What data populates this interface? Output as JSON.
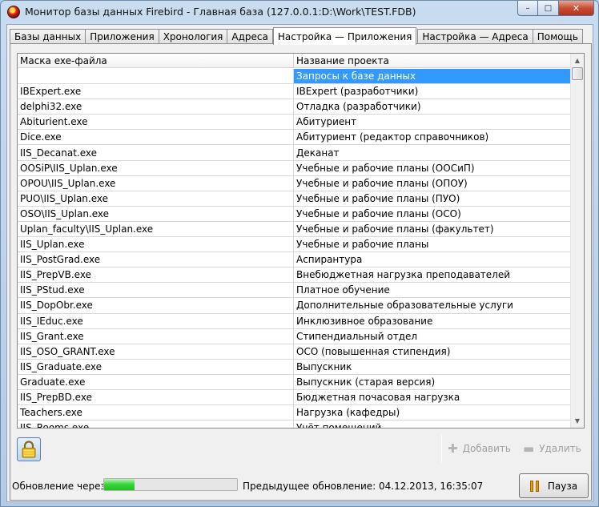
{
  "window": {
    "title": "Монитор базы данных Firebird - Главная база (127.0.0.1:D:\\Work\\TEST.FDB)",
    "controls": {
      "minimize": "–",
      "maximize": "□",
      "close": "✕"
    }
  },
  "tabs": [
    {
      "label": "Базы данных",
      "active": false
    },
    {
      "label": "Приложения",
      "active": false
    },
    {
      "label": "Хронология",
      "active": false
    },
    {
      "label": "Адреса",
      "active": false
    },
    {
      "label": "Настройка — Приложения",
      "active": true
    },
    {
      "label": "Настройка — Адреса",
      "active": false
    },
    {
      "label": "Помощь",
      "active": false
    }
  ],
  "grid": {
    "columns": [
      "Маска exe-файла",
      "Название проекта"
    ],
    "rows": [
      {
        "mask": "",
        "project": "Запросы к базе данных",
        "selected": true
      },
      {
        "mask": "IBExpert.exe",
        "project": "IBExpert (разработчики)"
      },
      {
        "mask": "delphi32.exe",
        "project": "Отладка (разработчики)"
      },
      {
        "mask": "Abiturient.exe",
        "project": "Абитуриент"
      },
      {
        "mask": "Dice.exe",
        "project": "Абитуриент (редактор справочников)"
      },
      {
        "mask": "IIS_Decanat.exe",
        "project": "Деканат"
      },
      {
        "mask": "OOSiP\\IIS_Uplan.exe",
        "project": "Учебные и рабочие планы (ООСиП)"
      },
      {
        "mask": "OPOU\\IIS_Uplan.exe",
        "project": "Учебные и рабочие планы (ОПОУ)"
      },
      {
        "mask": "PUO\\IIS_Uplan.exe",
        "project": "Учебные и рабочие планы (ПУО)"
      },
      {
        "mask": "OSO\\IIS_Uplan.exe",
        "project": "Учебные и рабочие планы (ОСО)"
      },
      {
        "mask": "Uplan_faculty\\IIS_Uplan.exe",
        "project": "Учебные и рабочие планы (факультет)"
      },
      {
        "mask": "IIS_Uplan.exe",
        "project": "Учебные и рабочие планы"
      },
      {
        "mask": "IIS_PostGrad.exe",
        "project": "Аспирантура"
      },
      {
        "mask": "IIS_PrepVB.exe",
        "project": "Внебюджетная нагрузка преподавателей"
      },
      {
        "mask": "IIS_PStud.exe",
        "project": "Платное обучение"
      },
      {
        "mask": "IIS_DopObr.exe",
        "project": "Дополнительные образовательные услуги"
      },
      {
        "mask": "IIS_IEduc.exe",
        "project": "Инклюзивное образование"
      },
      {
        "mask": "IIS_Grant.exe",
        "project": "Стипендиальный отдел"
      },
      {
        "mask": "IIS_OSO_GRANT.exe",
        "project": "ОСО (повышенная стипендия)"
      },
      {
        "mask": "IIS_Graduate.exe",
        "project": "Выпускник"
      },
      {
        "mask": "Graduate.exe",
        "project": "Выпускник (старая версия)"
      },
      {
        "mask": "IIS_PrepBD.exe",
        "project": "Бюджетная почасовая нагрузка"
      },
      {
        "mask": "Teachers.exe",
        "project": "Нагрузка (кафедры)"
      },
      {
        "mask": "IIS_Rooms.exe",
        "project": "Учёт помещений"
      }
    ]
  },
  "actions": {
    "lock_icon": "lock-icon",
    "add_label": "Добавить",
    "delete_label": "Удалить"
  },
  "status": {
    "refresh_label": "Обновление через",
    "refresh_progress": 0.23,
    "previous_update": "Предыдущее обновление: 04.12.2013, 16:35:07",
    "pause_label": "Пауза"
  },
  "colors": {
    "selection": "#3399ff",
    "progress": "#37d437",
    "pause_icon": "#f5b400"
  }
}
